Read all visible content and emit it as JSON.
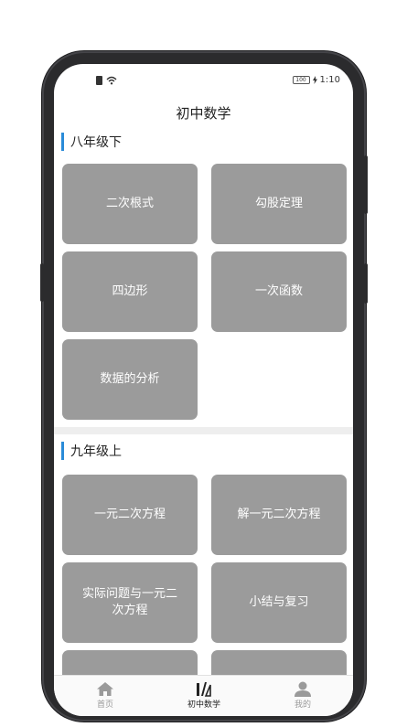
{
  "status_bar": {
    "time": "1:10",
    "battery": "100"
  },
  "header": {
    "title": "初中数学"
  },
  "sections": [
    {
      "title": "八年级下",
      "items": [
        "二次根式",
        "勾股定理",
        "四边形",
        "一次函数",
        "数据的分析"
      ]
    },
    {
      "title": "九年级上",
      "items": [
        "一元二次方程",
        "解一元二次方程",
        "实际问题与一元二次方程",
        "小结与复习",
        "",
        ""
      ]
    }
  ],
  "tabbar": {
    "items": [
      {
        "label": "首页",
        "icon": "home-icon"
      },
      {
        "label": "初中数学",
        "icon": "math-tools-icon"
      },
      {
        "label": "我的",
        "icon": "user-icon"
      }
    ],
    "active_color": "#222222",
    "inactive_color": "#999999"
  },
  "colors": {
    "accent": "#2a8bd8",
    "card": "#9b9b9b"
  }
}
